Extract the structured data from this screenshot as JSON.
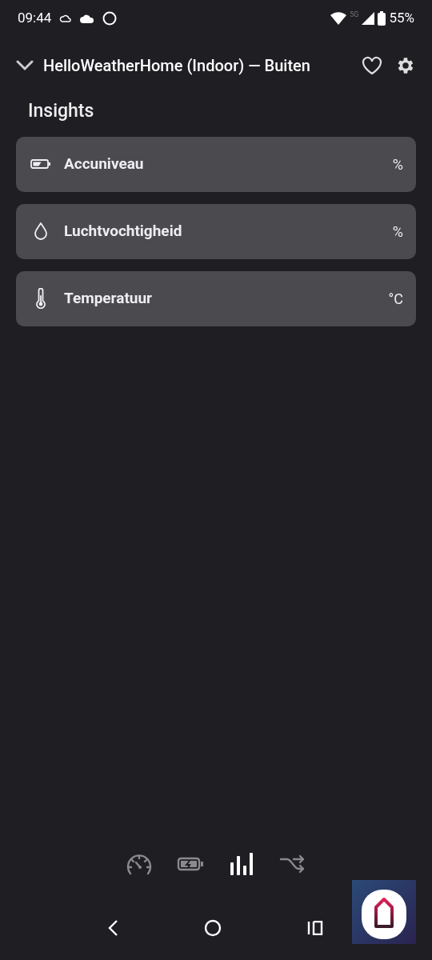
{
  "status_bar": {
    "time": "09:44",
    "battery": "55%",
    "network": "5G"
  },
  "header": {
    "title": "HelloWeatherHome (Indoor) — Buiten"
  },
  "section_title": "Insights",
  "insights": [
    {
      "kind": "battery",
      "label": "Accuniveau",
      "unit": "%"
    },
    {
      "kind": "humidity",
      "label": "Luchtvochtigheid",
      "unit": "%"
    },
    {
      "kind": "temperature",
      "label": "Temperatuur",
      "unit": "°C"
    }
  ],
  "tabs": [
    {
      "kind": "gauge",
      "selected": false
    },
    {
      "kind": "energy",
      "selected": false
    },
    {
      "kind": "insights",
      "selected": true
    },
    {
      "kind": "flows",
      "selected": false
    }
  ]
}
